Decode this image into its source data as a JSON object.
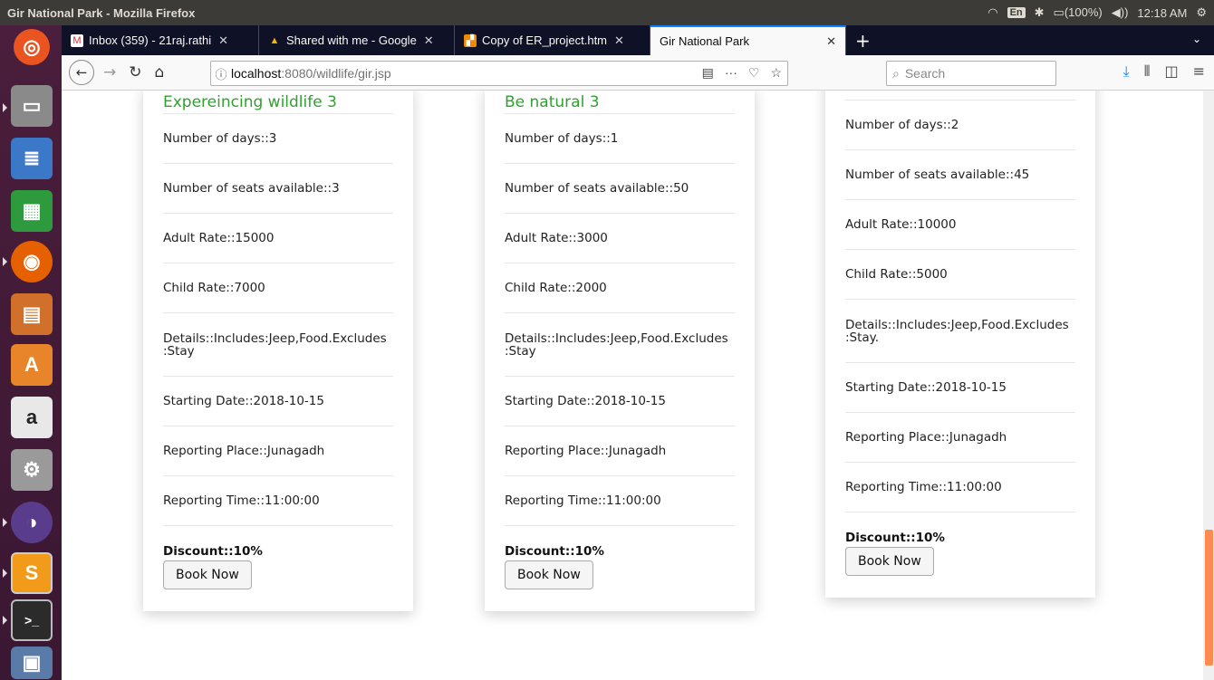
{
  "window": {
    "title": "Gir National Park - Mozilla Firefox"
  },
  "tray": {
    "language": "En",
    "battery": "(100%)",
    "time": "12:18 AM"
  },
  "tabs": [
    {
      "label": "Inbox (359) - 21raj.rathi",
      "icon": "gmail-icon"
    },
    {
      "label": "Shared with me - Google",
      "icon": "drive-icon"
    },
    {
      "label": "Copy of ER_project.htm",
      "icon": "draw-icon"
    },
    {
      "label": "Gir National Park",
      "icon": ""
    }
  ],
  "url": {
    "host": "localhost",
    "path": ":8080/wildlife/gir.jsp"
  },
  "search": {
    "placeholder": "Search"
  },
  "cards": [
    {
      "title": "Expereincing wildlife 3",
      "days": "Number of days::3",
      "seats": "Number of seats available::3",
      "adult": "Adult Rate::15000",
      "child": "Child Rate::7000",
      "details": "Details::Includes:Jeep,Food.Excludes :Stay",
      "start": "Starting Date::2018-10-15",
      "place": "Reporting Place::Junagadh",
      "time": "Reporting Time::11:00:00",
      "discount": "Discount::10%",
      "button": "Book Now"
    },
    {
      "title": "Be natural 3",
      "days": "Number of days::1",
      "seats": "Number of seats available::50",
      "adult": "Adult Rate::3000",
      "child": "Child Rate::2000",
      "details": "Details::Includes:Jeep,Food.Excludes :Stay",
      "start": "Starting Date::2018-10-15",
      "place": "Reporting Place::Junagadh",
      "time": "Reporting Time::11:00:00",
      "discount": "Discount::10%",
      "button": "Book Now"
    },
    {
      "title": "",
      "days": "Number of days::2",
      "seats": "Number of seats available::45",
      "adult": "Adult Rate::10000",
      "child": "Child Rate::5000",
      "details": "Details::Includes:Jeep,Food.Excludes :Stay.",
      "start": "Starting Date::2018-10-15",
      "place": "Reporting Place::Junagadh",
      "time": "Reporting Time::11:00:00",
      "discount": "Discount::10%",
      "button": "Book Now"
    }
  ],
  "colors": {
    "title_green": "#2fa12f",
    "tab_accent": "#0a84ff",
    "scroll_thumb": "#ff8a50"
  }
}
